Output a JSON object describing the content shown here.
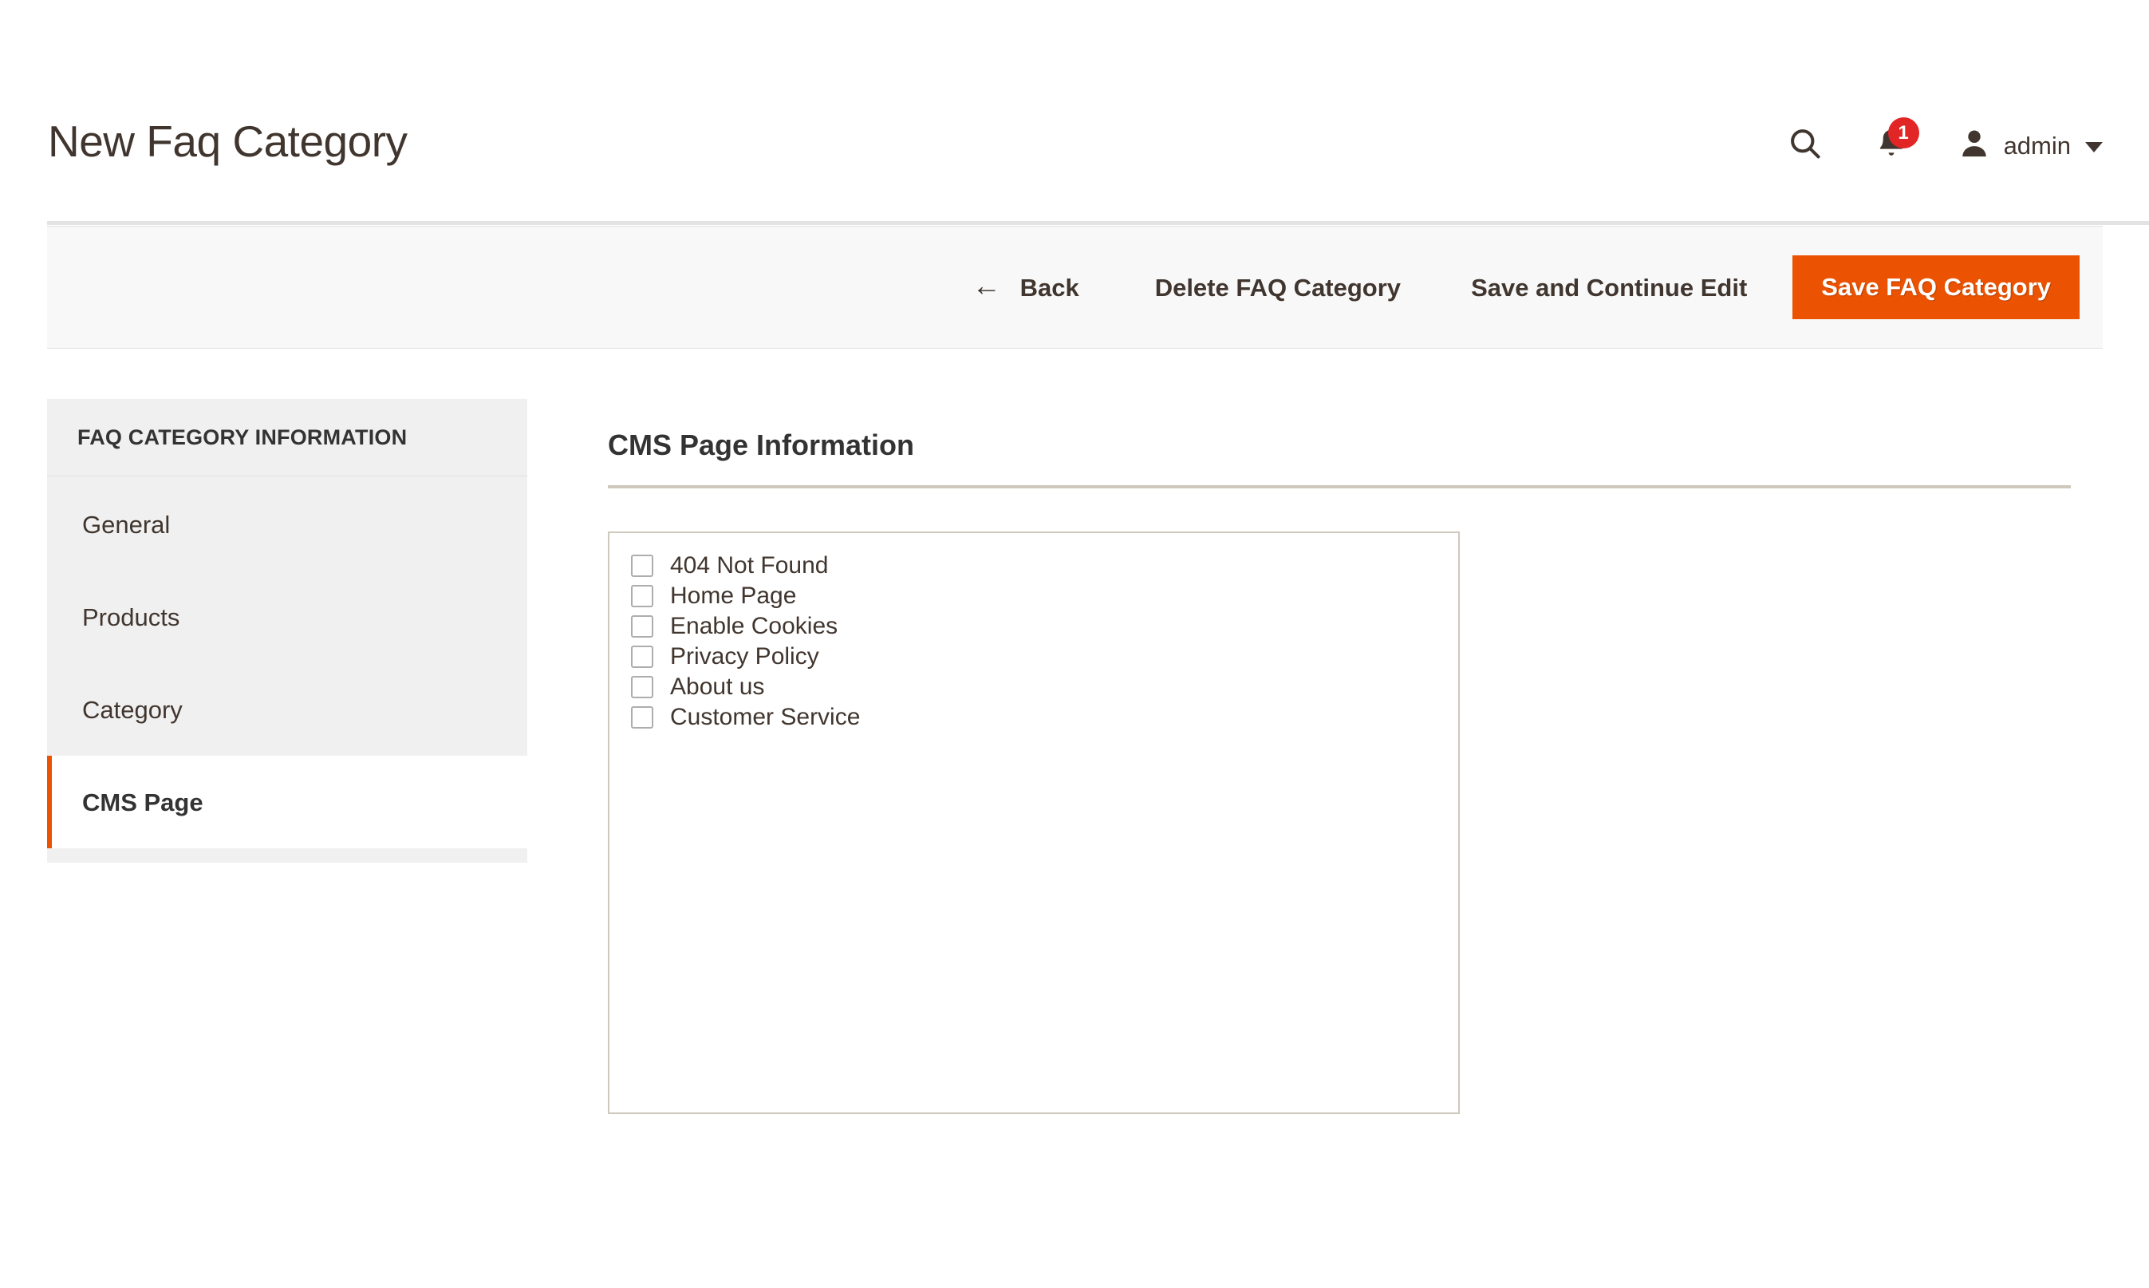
{
  "header": {
    "title": "New Faq Category",
    "search_icon": "search-icon",
    "notification_icon": "bell-icon",
    "notification_count": "1",
    "user_icon": "user-avatar-icon",
    "user_name": "admin",
    "caret_icon": "chevron-down-icon"
  },
  "toolbar": {
    "back_arrow": "←",
    "back_label": "Back",
    "delete_label": "Delete FAQ Category",
    "save_continue_label": "Save and Continue Edit",
    "save_label": "Save FAQ Category",
    "primary_color": "#eb5202"
  },
  "sidebar": {
    "header": "FAQ CATEGORY INFORMATION",
    "items": [
      {
        "label": "General",
        "active": false
      },
      {
        "label": "Products",
        "active": false
      },
      {
        "label": "Category",
        "active": false
      },
      {
        "label": "CMS Page",
        "active": true
      }
    ],
    "active_accent_color": "#eb5202"
  },
  "main": {
    "section_title": "CMS Page Information",
    "cms_pages": [
      {
        "label": "404 Not Found",
        "checked": false
      },
      {
        "label": "Home Page",
        "checked": false
      },
      {
        "label": "Enable Cookies",
        "checked": false
      },
      {
        "label": "Privacy Policy",
        "checked": false
      },
      {
        "label": "About us",
        "checked": false
      },
      {
        "label": "Customer Service",
        "checked": false
      }
    ]
  }
}
